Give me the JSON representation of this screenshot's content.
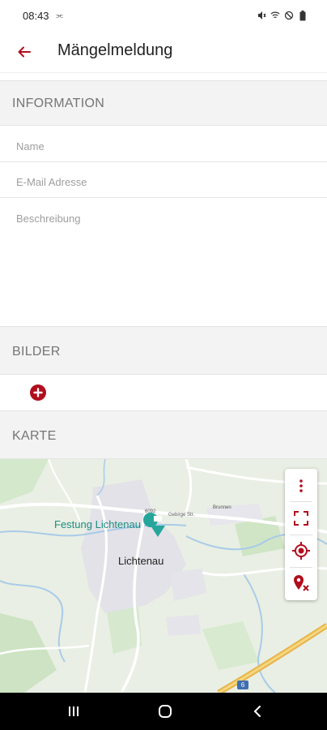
{
  "status_bar": {
    "time": "08:43",
    "extra": "⫘",
    "icons": [
      "mute-icon",
      "wifi-icon",
      "dnd-icon",
      "battery-icon"
    ]
  },
  "app_bar": {
    "back_icon": "arrow-left-icon",
    "title": "Mängelmeldung"
  },
  "sections": {
    "information": "INFORMATION",
    "images": "BILDER",
    "map": "KARTE"
  },
  "form": {
    "name_placeholder": "Name",
    "email_placeholder": "E-Mail Adresse",
    "description_placeholder": "Beschreibung"
  },
  "images": {
    "add_icon": "plus-circle-icon"
  },
  "map": {
    "place_label": "Festung Lichtenau",
    "town_label": "Lichtenau",
    "road_label_1": "6092",
    "road_label_2": "Gebirge Str.",
    "road_label_3": "Brunnen",
    "highway_badge": "6",
    "controls": [
      "more-vert-icon",
      "fullscreen-icon",
      "my-location-icon",
      "remove-marker-icon"
    ]
  },
  "colors": {
    "accent": "#b10e1e",
    "section_bg": "#f3f3f3",
    "map_marker": "#26a69a"
  },
  "nav_bar": {
    "buttons": [
      "recents-icon",
      "home-icon",
      "back-icon"
    ]
  }
}
